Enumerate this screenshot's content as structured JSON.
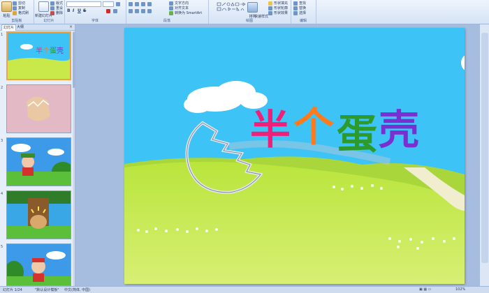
{
  "ribbon": {
    "clipboard": {
      "paste": "粘贴",
      "cut": "剪切",
      "copy": "复制",
      "format_painter": "格式刷",
      "group": "剪贴板"
    },
    "slides": {
      "new_slide": "新建幻灯片",
      "layout": "版式",
      "reset": "重设",
      "delete": "删除",
      "group": "幻灯片"
    },
    "font": {
      "group": "字体",
      "bold": "B",
      "italic": "I",
      "underline": "U",
      "strike": "S"
    },
    "paragraph": {
      "text_direction": "文字方向",
      "align_text": "对齐文本",
      "smartart": "转换为 SmartArt",
      "group": "段落"
    },
    "drawing": {
      "arrange": "排列",
      "quick_styles": "快速样式",
      "shape_fill": "形状填充",
      "shape_outline": "形状轮廓",
      "shape_effects": "形状效果",
      "group": "绘图"
    },
    "editing": {
      "find": "查找",
      "replace": "替换",
      "select": "选择",
      "group": "编辑"
    }
  },
  "left_panel": {
    "tabs": [
      "幻灯片",
      "大纲"
    ],
    "close": "×",
    "slides": [
      {
        "number": "1",
        "selected": true
      },
      {
        "number": "2"
      },
      {
        "number": "3"
      },
      {
        "number": "4"
      },
      {
        "number": "5"
      }
    ]
  },
  "slide": {
    "title_chars": [
      "半",
      "个",
      "蛋",
      "壳"
    ],
    "title_colors": [
      "#f0207a",
      "#ff7a1a",
      "#2c9b2c",
      "#7a2fd0"
    ],
    "sky_color": "#3ec3f6",
    "grass_color": "#c9e84a"
  },
  "status_bar": {
    "slide_index": "幻灯片 1/24",
    "theme": "\"默认设计模板\"",
    "language": "中文(简体, 中国)",
    "zoom": "102%"
  }
}
